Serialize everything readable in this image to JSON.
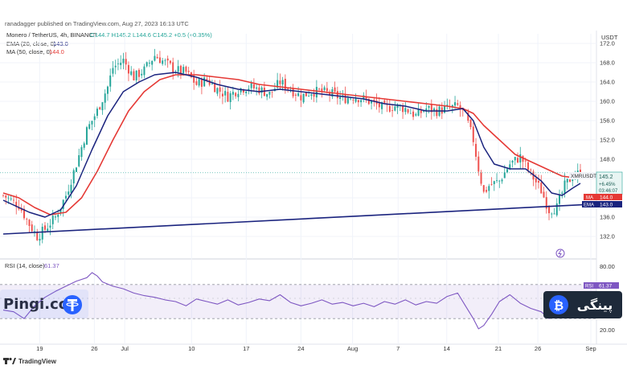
{
  "header": {
    "publisher": "ranadagger published on TradingView.com, Aug 27, 2023 16:13 UTC",
    "symbol": "Monero / TetherUS, 4h, BINANCE",
    "ohlc": "O144.7 H145.2 L144.6 C145.2 +0.5 (+0.35%)",
    "ema_label": "EMA (20, close, 0)",
    "ema_value": "143.0",
    "ma_label": "MA (50, close, 0)",
    "ma_value": "144.0",
    "currency": "USDT"
  },
  "badges": {
    "ticker": "XMRUSDT",
    "price": "145.2",
    "change": "+6.45%",
    "timer": "03:46:07",
    "ma_tag": "MA",
    "ma_price": "144.0",
    "ema_tag": "EMA",
    "ema_price": "143.0",
    "rsi_tag": "RSI",
    "rsi_value": "61.37"
  },
  "rsi_panel": {
    "label": "RSI (14, close)",
    "value": "61.37",
    "ticks": [
      "80.00",
      "20.00"
    ]
  },
  "watermarks": {
    "left": "Pingi.co",
    "right": "پینگی"
  },
  "footer": {
    "brand": "TradingView"
  },
  "colors": {
    "up": "#26a69a",
    "down": "#ef5350",
    "ema": "#1a237e",
    "ma": "#e53935",
    "rsi": "#7e57c2",
    "trendline": "#1a237e",
    "watermark_blue": "#2962ff"
  },
  "chart_data": {
    "type": "candlestick",
    "interval": "4h",
    "ylim": [
      128,
      174
    ],
    "y_ticks": [
      "172.0",
      "168.0",
      "164.0",
      "160.0",
      "156.0",
      "152.0",
      "148.0",
      "144.0",
      "140.0",
      "136.0",
      "132.0"
    ],
    "x_ticks": [
      "19",
      "26",
      "Jul",
      "10",
      "17",
      "24",
      "Aug",
      "7",
      "14",
      "21",
      "26",
      "Sep"
    ],
    "close_path": [
      [
        0,
        140.5
      ],
      [
        6,
        138.5
      ],
      [
        10,
        134.5
      ],
      [
        13,
        132.0
      ],
      [
        16,
        133.5
      ],
      [
        20,
        136.0
      ],
      [
        24,
        140.5
      ],
      [
        28,
        147.0
      ],
      [
        32,
        154.0
      ],
      [
        36,
        158.0
      ],
      [
        40,
        163.0
      ],
      [
        42,
        167.0
      ],
      [
        46,
        168.5
      ],
      [
        50,
        165.0
      ],
      [
        54,
        166.5
      ],
      [
        58,
        169.5
      ],
      [
        62,
        168.0
      ],
      [
        66,
        166.5
      ],
      [
        70,
        166.0
      ],
      [
        74,
        163.5
      ],
      [
        78,
        164.5
      ],
      [
        82,
        162.5
      ],
      [
        86,
        161.0
      ],
      [
        90,
        162.5
      ],
      [
        94,
        163.0
      ],
      [
        98,
        162.5
      ],
      [
        102,
        161.5
      ],
      [
        106,
        164.0
      ],
      [
        110,
        162.5
      ],
      [
        114,
        161.0
      ],
      [
        118,
        162.0
      ],
      [
        122,
        162.0
      ],
      [
        126,
        161.5
      ],
      [
        130,
        160.5
      ],
      [
        134,
        161.0
      ],
      [
        138,
        160.5
      ],
      [
        142,
        159.5
      ],
      [
        146,
        158.5
      ],
      [
        150,
        159.0
      ],
      [
        154,
        158.5
      ],
      [
        158,
        157.0
      ],
      [
        162,
        158.5
      ],
      [
        166,
        158.0
      ],
      [
        170,
        158.5
      ],
      [
        174,
        159.0
      ],
      [
        177,
        157.0
      ],
      [
        180,
        152.0
      ],
      [
        182,
        146.0
      ],
      [
        184,
        141.0
      ],
      [
        186,
        142.5
      ],
      [
        190,
        143.5
      ],
      [
        194,
        147.0
      ],
      [
        198,
        148.5
      ],
      [
        202,
        145.0
      ],
      [
        206,
        141.5
      ],
      [
        209,
        137.5
      ],
      [
        212,
        138.0
      ],
      [
        215,
        142.5
      ],
      [
        218,
        144.5
      ],
      [
        221,
        145.2
      ]
    ],
    "ema_20_path": [
      [
        0,
        139.5
      ],
      [
        10,
        137.0
      ],
      [
        16,
        136.0
      ],
      [
        22,
        137.5
      ],
      [
        28,
        142.5
      ],
      [
        34,
        150.0
      ],
      [
        40,
        157.0
      ],
      [
        46,
        162.0
      ],
      [
        52,
        164.0
      ],
      [
        58,
        165.5
      ],
      [
        66,
        166.0
      ],
      [
        74,
        165.0
      ],
      [
        82,
        163.5
      ],
      [
        90,
        162.5
      ],
      [
        98,
        162.0
      ],
      [
        106,
        162.5
      ],
      [
        114,
        162.0
      ],
      [
        122,
        161.5
      ],
      [
        130,
        161.0
      ],
      [
        138,
        160.5
      ],
      [
        146,
        159.5
      ],
      [
        154,
        159.0
      ],
      [
        162,
        158.0
      ],
      [
        170,
        158.0
      ],
      [
        176,
        158.5
      ],
      [
        180,
        156.0
      ],
      [
        184,
        150.5
      ],
      [
        188,
        147.0
      ],
      [
        194,
        146.0
      ],
      [
        200,
        146.0
      ],
      [
        206,
        143.5
      ],
      [
        210,
        141.0
      ],
      [
        214,
        140.5
      ],
      [
        218,
        142.0
      ],
      [
        221,
        143.0
      ]
    ],
    "ma_50_path": [
      [
        0,
        141.0
      ],
      [
        6,
        140.0
      ],
      [
        12,
        138.0
      ],
      [
        18,
        136.5
      ],
      [
        24,
        137.0
      ],
      [
        30,
        140.0
      ],
      [
        36,
        145.5
      ],
      [
        42,
        152.0
      ],
      [
        48,
        158.0
      ],
      [
        54,
        162.0
      ],
      [
        60,
        164.5
      ],
      [
        66,
        165.5
      ],
      [
        74,
        165.5
      ],
      [
        82,
        165.0
      ],
      [
        90,
        164.5
      ],
      [
        98,
        163.5
      ],
      [
        106,
        163.0
      ],
      [
        114,
        162.5
      ],
      [
        122,
        162.0
      ],
      [
        130,
        161.5
      ],
      [
        138,
        161.0
      ],
      [
        146,
        160.5
      ],
      [
        154,
        160.0
      ],
      [
        162,
        159.5
      ],
      [
        170,
        159.0
      ],
      [
        176,
        158.5
      ],
      [
        180,
        157.5
      ],
      [
        184,
        155.0
      ],
      [
        190,
        152.0
      ],
      [
        196,
        149.0
      ],
      [
        202,
        147.5
      ],
      [
        208,
        146.0
      ],
      [
        214,
        144.5
      ],
      [
        218,
        144.2
      ],
      [
        221,
        144.0
      ]
    ],
    "trendline": [
      [
        0,
        132.5
      ],
      [
        221,
        138.5
      ]
    ],
    "rsi_ylim": [
      0,
      100
    ],
    "rsi_levels": [
      70,
      30
    ],
    "rsi_path": [
      [
        0,
        40
      ],
      [
        4,
        38
      ],
      [
        8,
        30
      ],
      [
        12,
        45
      ],
      [
        16,
        55
      ],
      [
        20,
        62
      ],
      [
        24,
        68
      ],
      [
        28,
        74
      ],
      [
        32,
        78
      ],
      [
        34,
        84
      ],
      [
        36,
        80
      ],
      [
        38,
        73
      ],
      [
        42,
        68
      ],
      [
        46,
        65
      ],
      [
        50,
        60
      ],
      [
        54,
        57
      ],
      [
        58,
        55
      ],
      [
        62,
        52
      ],
      [
        66,
        50
      ],
      [
        70,
        45
      ],
      [
        74,
        53
      ],
      [
        78,
        50
      ],
      [
        82,
        47
      ],
      [
        86,
        52
      ],
      [
        90,
        46
      ],
      [
        94,
        49
      ],
      [
        98,
        53
      ],
      [
        102,
        51
      ],
      [
        106,
        58
      ],
      [
        110,
        49
      ],
      [
        114,
        45
      ],
      [
        118,
        48
      ],
      [
        122,
        52
      ],
      [
        126,
        47
      ],
      [
        130,
        49
      ],
      [
        134,
        45
      ],
      [
        138,
        48
      ],
      [
        142,
        44
      ],
      [
        146,
        50
      ],
      [
        150,
        47
      ],
      [
        154,
        52
      ],
      [
        158,
        46
      ],
      [
        162,
        50
      ],
      [
        166,
        48
      ],
      [
        170,
        56
      ],
      [
        174,
        60
      ],
      [
        177,
        45
      ],
      [
        180,
        30
      ],
      [
        182,
        18
      ],
      [
        184,
        22
      ],
      [
        187,
        35
      ],
      [
        190,
        50
      ],
      [
        194,
        58
      ],
      [
        198,
        48
      ],
      [
        202,
        42
      ],
      [
        206,
        38
      ],
      [
        209,
        30
      ],
      [
        212,
        35
      ],
      [
        215,
        50
      ],
      [
        218,
        58
      ],
      [
        221,
        61.37
      ]
    ]
  }
}
